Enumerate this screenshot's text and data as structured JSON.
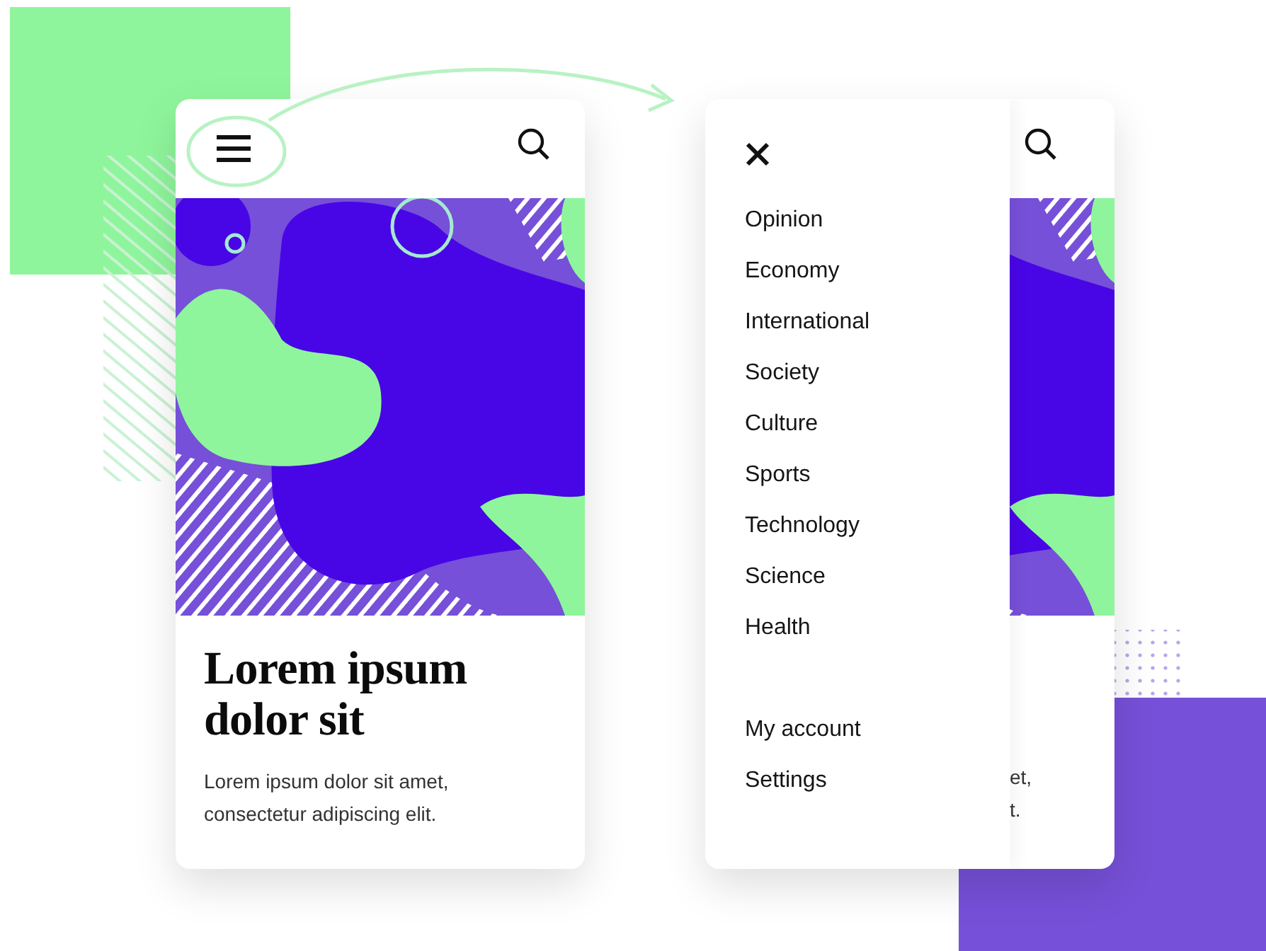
{
  "article_screen": {
    "headline": "Lorem ipsum dolor sit",
    "body": "Lorem ipsum dolor sit amet, consectetur adipiscing elit."
  },
  "menu_screen": {
    "menu_items": [
      "Opinion",
      "Economy",
      "International",
      "Society",
      "Culture",
      "Sports",
      "Technology",
      "Science",
      "Health"
    ],
    "account_items": [
      "My account",
      "Settings"
    ],
    "peek_lines": [
      "et,",
      "t."
    ]
  }
}
